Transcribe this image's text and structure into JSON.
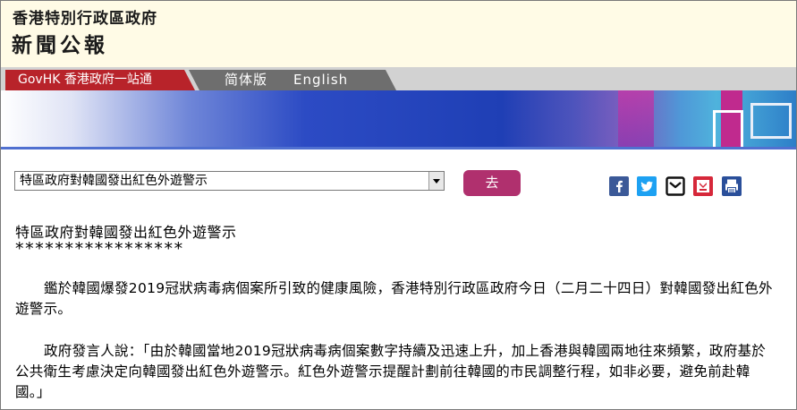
{
  "header": {
    "org_name": "香港特別行政區政府",
    "publication": "新聞公報"
  },
  "nav": {
    "gov_link": "GovHK 香港政府一站通",
    "simplified_link": "简体版",
    "english_link": "English"
  },
  "article_select": {
    "selected": "特區政府對韓國發出紅色外遊警示"
  },
  "go_button": "去",
  "share_icons": [
    "facebook-icon",
    "twitter-icon",
    "email-icon",
    "bookmark-icon",
    "print-icon"
  ],
  "colors": {
    "gov_tab": "#b8232a",
    "go_button": "#b0306e",
    "facebook": "#3b5998",
    "twitter": "#1da1f2",
    "bookmark": "#d6283a",
    "print": "#2a4f9a"
  },
  "article": {
    "title": "特區政府對韓國發出紅色外遊警示",
    "stars": "*****************",
    "paragraphs": [
      "鑑於韓國爆發2019冠狀病毒病個案所引致的健康風險，香港特別行政區政府今日（二月二十四日）對韓國發出紅色外遊警示。",
      "政府發言人說：「由於韓國當地2019冠狀病毒病個案數字持續及迅速上升，加上香港與韓國兩地往來頻繁，政府基於公共衛生考慮決定向韓國發出紅色外遊警示。紅色外遊警示提醒計劃前往韓國的市民調整行程，如非必要，避免前赴韓國。」"
    ]
  }
}
